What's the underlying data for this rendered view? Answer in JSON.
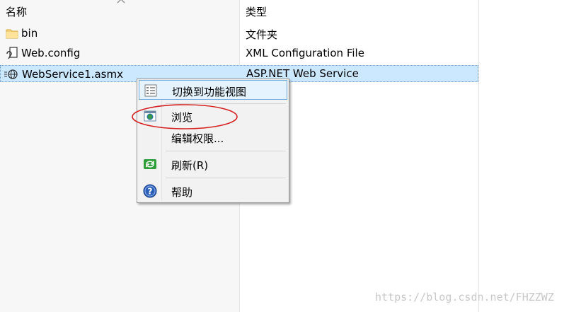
{
  "header": {
    "name_col": "名称",
    "type_col": "类型"
  },
  "files": [
    {
      "icon": "folder-icon",
      "name": "bin",
      "type": "文件夹"
    },
    {
      "icon": "config-file-icon",
      "name": "Web.config",
      "type": "XML Configuration File"
    },
    {
      "icon": "web-service-icon",
      "name": "WebService1.asmx",
      "type": "ASP.NET Web Service"
    }
  ],
  "context_menu": {
    "items": [
      {
        "label": "切换到功能视图",
        "icon": "feature-view-icon"
      },
      {
        "label": "浏览",
        "icon": "browse-icon"
      },
      {
        "label": "编辑权限...",
        "icon": ""
      },
      {
        "label": "刷新(R)",
        "icon": "refresh-icon"
      },
      {
        "label": "帮助",
        "icon": "help-icon"
      }
    ]
  },
  "colors": {
    "selection": "#cce8ff",
    "annotation": "#d62020",
    "menu_bg": "#f2f2f2"
  },
  "watermark": "https://blog.csdn.net/FHZZWZ"
}
